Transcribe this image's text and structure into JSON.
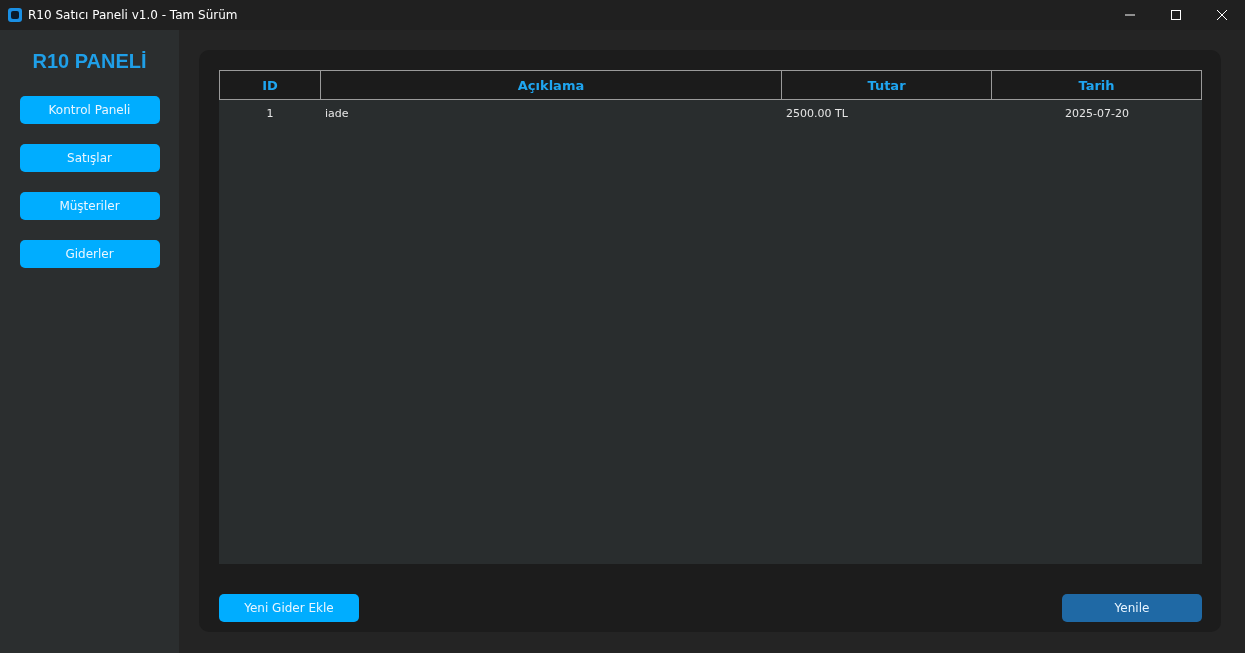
{
  "window": {
    "title": "R10 Satıcı Paneli v1.0 - Tam Sürüm"
  },
  "sidebar": {
    "title": "R10 PANELİ",
    "items": [
      {
        "label": "Kontrol Paneli"
      },
      {
        "label": "Satışlar"
      },
      {
        "label": "Müşteriler"
      },
      {
        "label": "Giderler"
      }
    ]
  },
  "table": {
    "columns": [
      {
        "label": "ID"
      },
      {
        "label": "Açıklama"
      },
      {
        "label": "Tutar"
      },
      {
        "label": "Tarih"
      }
    ],
    "rows": [
      [
        "1",
        "iade",
        "2500.00 TL",
        "2025-07-20"
      ]
    ]
  },
  "buttons": [
    {
      "label": "Yeni Gider Ekle",
      "kind": "primary"
    },
    {
      "label": "Yenile",
      "kind": "secondary"
    }
  ]
}
